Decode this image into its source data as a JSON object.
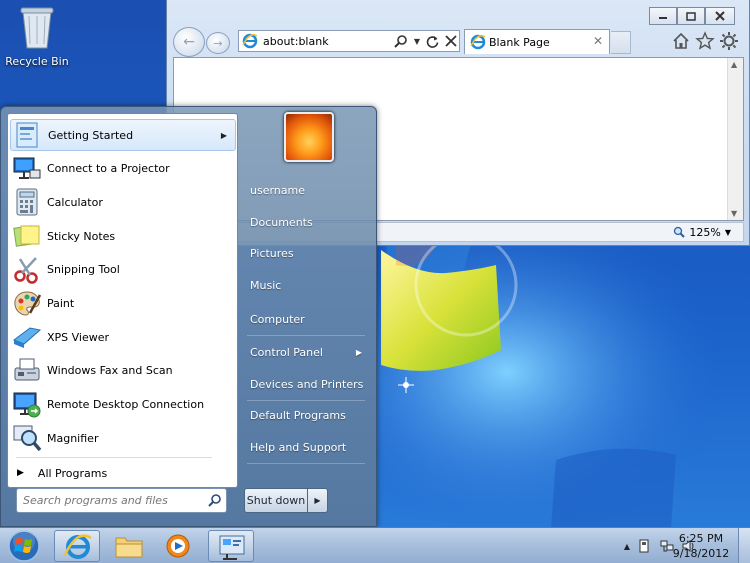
{
  "desktop": {
    "recycle_bin_label": "Recycle Bin"
  },
  "browser": {
    "address": "about:blank",
    "tab_title": "Blank Page",
    "zoom": "125%"
  },
  "start_menu": {
    "programs": [
      {
        "label": "Getting Started",
        "icon": "getting-started-icon",
        "has_submenu": true
      },
      {
        "label": "Connect to a Projector",
        "icon": "projector-icon",
        "has_submenu": false
      },
      {
        "label": "Calculator",
        "icon": "calculator-icon",
        "has_submenu": false
      },
      {
        "label": "Sticky Notes",
        "icon": "sticky-notes-icon",
        "has_submenu": false
      },
      {
        "label": "Snipping Tool",
        "icon": "scissors-icon",
        "has_submenu": false
      },
      {
        "label": "Paint",
        "icon": "paint-palette-icon",
        "has_submenu": false
      },
      {
        "label": "XPS Viewer",
        "icon": "xps-viewer-icon",
        "has_submenu": false
      },
      {
        "label": "Windows Fax and Scan",
        "icon": "fax-icon",
        "has_submenu": false
      },
      {
        "label": "Remote Desktop Connection",
        "icon": "remote-desktop-icon",
        "has_submenu": false
      },
      {
        "label": "Magnifier",
        "icon": "magnifier-icon",
        "has_submenu": false
      }
    ],
    "all_programs_label": "All Programs",
    "search_placeholder": "Search programs and files",
    "places": [
      {
        "label": "username"
      },
      {
        "label": "Documents"
      },
      {
        "label": "Pictures"
      },
      {
        "label": "Music"
      },
      {
        "label": "Computer"
      },
      {
        "label": "Control Panel",
        "has_submenu": true
      },
      {
        "label": "Devices and Printers"
      },
      {
        "label": "Default Programs"
      },
      {
        "label": "Help and Support"
      }
    ],
    "shutdown_label": "Shut down"
  },
  "taskbar": {
    "pinned": [
      "internet-explorer-icon",
      "folder-icon",
      "media-player-icon",
      "control-panel-icon"
    ],
    "clock_time": "6:25 PM",
    "clock_date": "9/18/2012"
  },
  "colors": {
    "desktop_blue": "#1a60c8",
    "highlight": "#d6e8fb"
  }
}
